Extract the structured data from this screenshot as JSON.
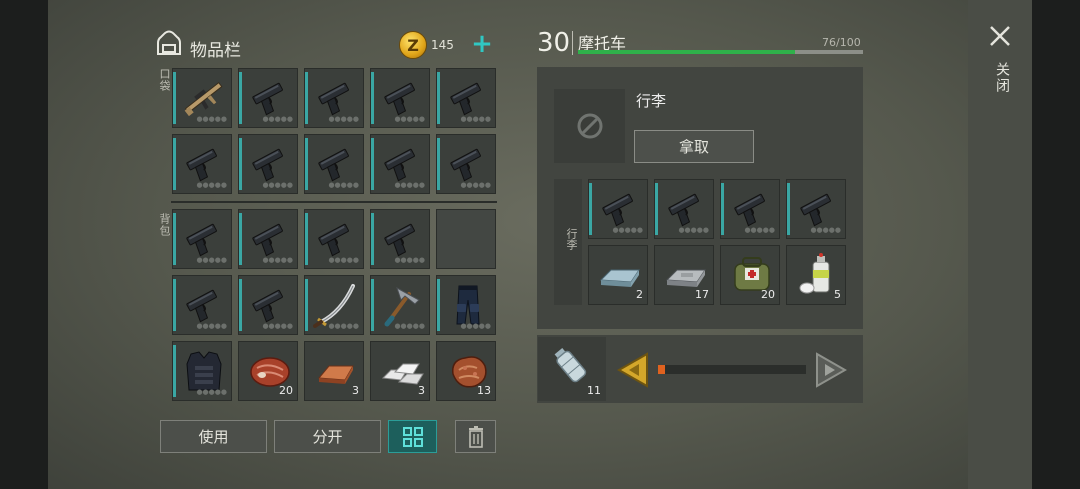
{
  "inventory": {
    "title": "物品栏",
    "coins": "145",
    "add_coin": "+",
    "coin_symbol": "Z",
    "pocket_label": "口袋",
    "backpack_label": "背包",
    "pocket_slots": [
      {
        "icon": "rifle-icon",
        "qty": ""
      },
      {
        "icon": "pistol-icon",
        "qty": ""
      },
      {
        "icon": "pistol-icon",
        "qty": ""
      },
      {
        "icon": "pistol-icon",
        "qty": ""
      },
      {
        "icon": "pistol-icon",
        "qty": ""
      },
      {
        "icon": "pistol-icon",
        "qty": ""
      },
      {
        "icon": "pistol-icon",
        "qty": ""
      },
      {
        "icon": "pistol-icon",
        "qty": ""
      },
      {
        "icon": "pistol-icon",
        "qty": ""
      },
      {
        "icon": "pistol-icon",
        "qty": ""
      }
    ],
    "backpack_slots": [
      {
        "icon": "pistol-icon",
        "qty": ""
      },
      {
        "icon": "pistol-icon",
        "qty": ""
      },
      {
        "icon": "pistol-icon",
        "qty": ""
      },
      {
        "icon": "pistol-icon",
        "qty": ""
      },
      {
        "icon": "",
        "qty": ""
      },
      {
        "icon": "pistol-icon",
        "qty": ""
      },
      {
        "icon": "pistol-icon",
        "qty": ""
      },
      {
        "icon": "katana-icon",
        "qty": ""
      },
      {
        "icon": "pickaxe-icon",
        "qty": ""
      },
      {
        "icon": "armored-pants-icon",
        "qty": ""
      },
      {
        "icon": "armored-vest-icon",
        "qty": ""
      },
      {
        "icon": "steak-icon",
        "qty": "20"
      },
      {
        "icon": "copper-ingot-icon",
        "qty": "3"
      },
      {
        "icon": "aluminum-bars-icon",
        "qty": "3"
      },
      {
        "icon": "raw-meat-icon",
        "qty": "13"
      }
    ]
  },
  "buttons": {
    "use": "使用",
    "split": "分开",
    "arrange": "grid-icon",
    "delete": "trash-icon"
  },
  "vehicle": {
    "level": "30",
    "name": "摩托车",
    "durability": "76/100",
    "durability_value": 76,
    "durability_max": 100,
    "cargo_title": "行李",
    "take_label": "拿取",
    "cargo_side_label": "行李",
    "cargo_slots": [
      {
        "icon": "pistol-icon",
        "qty": ""
      },
      {
        "icon": "pistol-icon",
        "qty": ""
      },
      {
        "icon": "pistol-icon",
        "qty": ""
      },
      {
        "icon": "pistol-icon",
        "qty": ""
      },
      {
        "icon": "metal-ingot-icon",
        "qty": "2"
      },
      {
        "icon": "iron-bar-icon",
        "qty": "17"
      },
      {
        "icon": "medkit-bag-icon",
        "qty": "20"
      },
      {
        "icon": "spray-can-icon",
        "qty": "5"
      }
    ],
    "fuel_qty": "11",
    "fuel_level": 0.05
  },
  "close": {
    "label": "关闭"
  },
  "colors": {
    "accent_teal": "#3aa7a4",
    "durability_green": "#2fb14a",
    "fuel_orange": "#e0621f",
    "arrow_gold": "#d4a72a"
  }
}
